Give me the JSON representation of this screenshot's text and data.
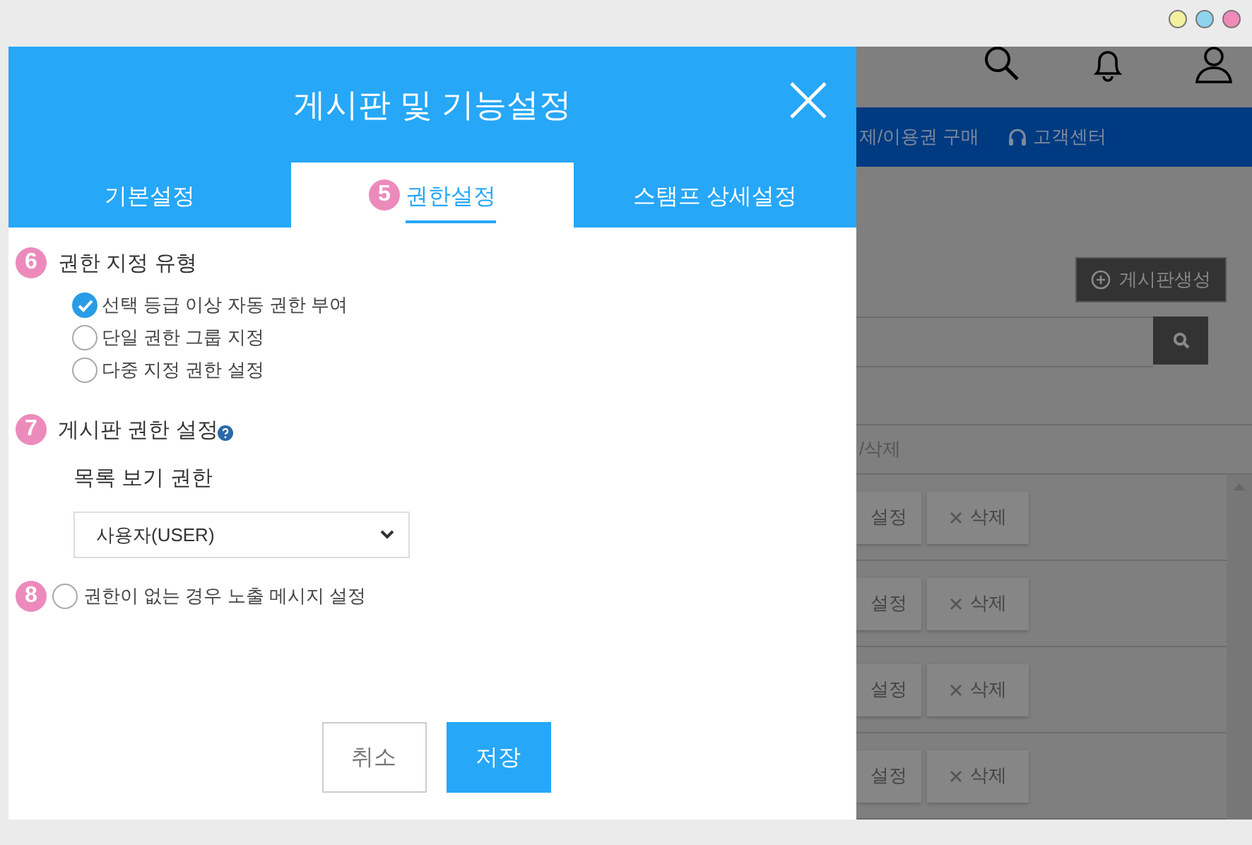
{
  "background_page": {
    "nav": [
      {
        "label": "제/이용권 구매"
      },
      {
        "label": "고객센터"
      }
    ],
    "create_button": "게시판생성",
    "table": {
      "column_header": "/삭제",
      "rows": [
        {
          "settings": "설정",
          "delete": "삭제"
        },
        {
          "settings": "설정",
          "delete": "삭제"
        },
        {
          "settings": "설정",
          "delete": "삭제"
        },
        {
          "settings": "설정",
          "delete": "삭제"
        }
      ]
    }
  },
  "modal": {
    "title": "게시판 및 기능설정",
    "tabs": [
      {
        "label": "기본설정",
        "selected": false
      },
      {
        "label": "권한설정",
        "selected": true,
        "badge": "5"
      },
      {
        "label": "스탬프 상세설정",
        "selected": false
      }
    ],
    "permission_type": {
      "badge": "6",
      "title": "권한 지정 유형",
      "options": [
        {
          "label": "선택 등급 이상 자동 권한 부여",
          "selected": true
        },
        {
          "label": "단일 권한 그룹 지정",
          "selected": false
        },
        {
          "label": "다중 지정 권한 설정",
          "selected": false
        }
      ]
    },
    "board_permission": {
      "badge": "7",
      "title": "게시판 권한 설정",
      "field_label": "목록 보기 권한",
      "select_value": "사용자(USER)"
    },
    "no_permission_message": {
      "badge": "8",
      "label": "권한이 없는 경우 노출 메시지 설정",
      "checked": false
    },
    "buttons": [
      {
        "label": "취소",
        "kind": "secondary"
      },
      {
        "label": "저장",
        "kind": "primary"
      }
    ]
  }
}
